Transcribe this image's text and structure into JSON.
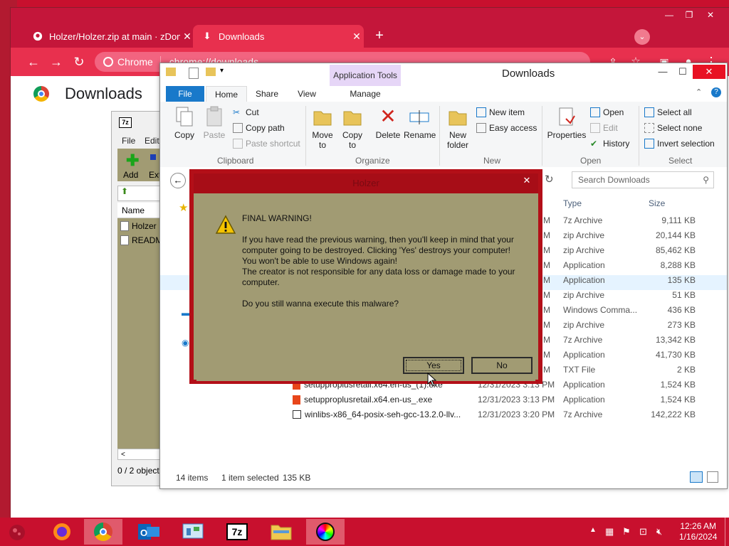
{
  "chrome": {
    "tabs": [
      {
        "label": "Holzer/Holzer.zip at main · zDom",
        "icon": "github-icon"
      },
      {
        "label": "Downloads",
        "icon": "download-icon"
      }
    ],
    "omnibox": {
      "chip": "Chrome",
      "url": "chrome://downloads"
    },
    "page_title": "Downloads"
  },
  "sevenzip": {
    "logo": "7z",
    "menu": [
      "File",
      "Edit"
    ],
    "toolbar": {
      "add": "Add",
      "extract": "Ext"
    },
    "column_name": "Name",
    "files": [
      "Holzer",
      "READM"
    ],
    "status": "0 / 2 object"
  },
  "explorer": {
    "app_tools": "Application Tools",
    "title": "Downloads",
    "tabs": [
      "File",
      "Home",
      "Share",
      "View",
      "Manage"
    ],
    "ribbon": {
      "clipboard": {
        "copy": "Copy",
        "paste": "Paste",
        "cut": "Cut",
        "copy_path": "Copy path",
        "paste_shortcut": "Paste shortcut",
        "group": "Clipboard"
      },
      "organize": {
        "move_to": "Move to",
        "copy_to": "Copy to",
        "delete": "Delete",
        "rename": "Rename",
        "group": "Organize"
      },
      "new": {
        "new_folder": "New folder",
        "new_item": "New item",
        "easy_access": "Easy access",
        "group": "New"
      },
      "open": {
        "properties": "Properties",
        "open": "Open",
        "edit": "Edit",
        "history": "History",
        "group": "Open"
      },
      "select": {
        "select_all": "Select all",
        "select_none": "Select none",
        "invert": "Invert selection",
        "group": "Select"
      }
    },
    "search_placeholder": "Search Downloads",
    "columns": {
      "type": "Type",
      "size": "Size"
    },
    "rows": [
      {
        "time": "M",
        "type": "7z Archive",
        "size": "9,111 KB"
      },
      {
        "time": "M",
        "type": "zip Archive",
        "size": "20,144 KB"
      },
      {
        "time": "M",
        "type": "zip Archive",
        "size": "85,462 KB"
      },
      {
        "time": "M",
        "type": "Application",
        "size": "8,288 KB"
      },
      {
        "time": "M",
        "type": "Application",
        "size": "135 KB",
        "selected": true
      },
      {
        "time": "M",
        "type": "zip Archive",
        "size": "51 KB"
      },
      {
        "time": "M",
        "type": "Windows Comma...",
        "size": "436 KB"
      },
      {
        "time": "M",
        "type": "zip Archive",
        "size": "273 KB"
      },
      {
        "time": "M",
        "type": "7z Archive",
        "size": "13,342 KB"
      },
      {
        "time": "M",
        "type": "Application",
        "size": "41,730 KB"
      },
      {
        "time": "M",
        "type": "TXT File",
        "size": "2 KB"
      },
      {
        "name": "setupproplusretail.x64.en-us_(1).exe",
        "date": "12/31/2023 3:13 PM",
        "type": "Application",
        "size": "1,524 KB"
      },
      {
        "name": "setupproplusretail.x64.en-us_.exe",
        "date": "12/31/2023 3:13 PM",
        "type": "Application",
        "size": "1,524 KB"
      },
      {
        "name": "winlibs-x86_64-posix-seh-gcc-13.2.0-llv...",
        "date": "12/31/2023 3:20 PM",
        "type": "7z Archive",
        "size": "142,222 KB"
      }
    ],
    "status": {
      "items": "14 items",
      "selected": "1 item selected",
      "size": "135 KB"
    }
  },
  "dialog": {
    "title": "Holzer",
    "heading": "FINAL WARNING!",
    "lines": [
      "If you have read the previous warning, then you'll keep in mind that your",
      "computer going to be destroyed. Clicking 'Yes' destroys your computer!",
      "You won't be able to use Windows again!",
      "The creator is not responsible for any data loss or damage made to your computer."
    ],
    "question": "Do you still wanna execute this malware?",
    "yes": "Yes",
    "no": "No"
  },
  "taskbar": {
    "apps": [
      "firefox-icon",
      "chrome-icon",
      "outlook-icon",
      "control-panel-icon",
      "7zip-icon",
      "file-explorer-icon",
      "color-wheel-icon"
    ],
    "tray": {
      "time": "12:26 AM",
      "date": "1/16/2024"
    }
  }
}
